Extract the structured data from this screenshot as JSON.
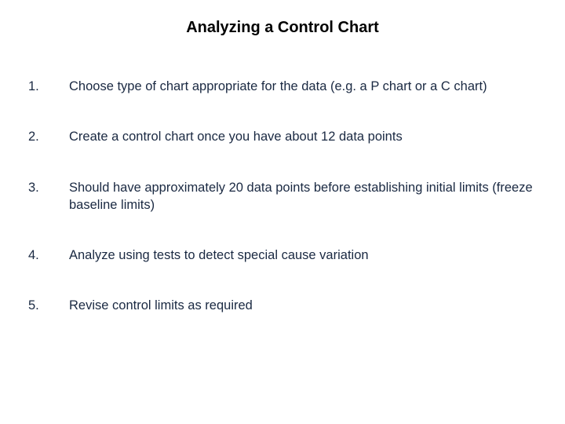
{
  "title": "Analyzing a Control Chart",
  "items": [
    {
      "num": "1.",
      "text": "Choose type of chart appropriate for the data (e.g. a P chart or a C chart)"
    },
    {
      "num": "2.",
      "text": "Create a control chart once you have about 12 data points"
    },
    {
      "num": "3.",
      "text": "Should have approximately 20 data points before establishing initial limits (freeze baseline limits)"
    },
    {
      "num": "4.",
      "text": "Analyze using tests to detect special cause variation"
    },
    {
      "num": "5.",
      "text": "Revise control limits as required"
    }
  ]
}
